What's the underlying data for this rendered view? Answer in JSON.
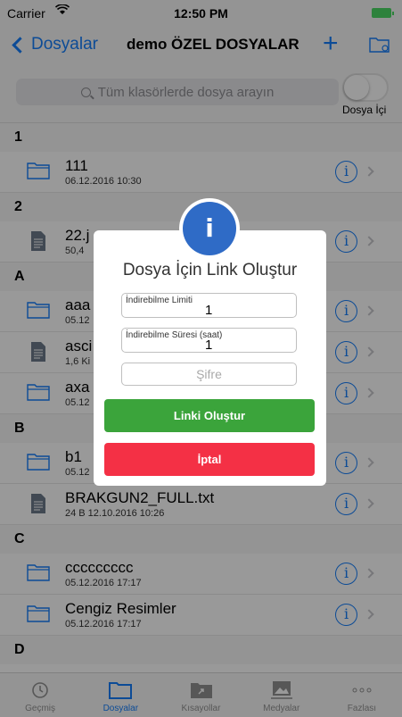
{
  "status_bar": {
    "carrier": "Carrier",
    "time": "12:50 PM"
  },
  "nav": {
    "back_label": "Dosyalar",
    "title": "demo ÖZEL DOSYALAR",
    "add": "+"
  },
  "search": {
    "placeholder": "Tüm klasörlerde dosya arayın",
    "toggle_label": "Dosya İçi"
  },
  "sections": [
    {
      "letter": "1",
      "rows": [
        {
          "name": "111",
          "meta": "06.12.2016 10:30",
          "icon": "folder-icon"
        }
      ]
    },
    {
      "letter": "2",
      "rows": [
        {
          "name": "22.j",
          "meta": "50,4",
          "icon": "file-icon"
        }
      ]
    },
    {
      "letter": "A",
      "rows": [
        {
          "name": "aaa",
          "meta": "05.12",
          "icon": "folder-icon"
        },
        {
          "name": "asci",
          "meta": "1,6 Ki",
          "icon": "file-icon"
        },
        {
          "name": "axa",
          "meta": "05.12",
          "icon": "folder-icon"
        }
      ]
    },
    {
      "letter": "B",
      "rows": [
        {
          "name": "b1",
          "meta": "05.12",
          "icon": "folder-icon"
        },
        {
          "name": "BRAKGUN2_FULL.txt",
          "meta": "24 B   12.10.2016 10:26",
          "icon": "file-icon"
        }
      ]
    },
    {
      "letter": "C",
      "rows": [
        {
          "name": "ccccccccc",
          "meta": "05.12.2016 17:17",
          "icon": "folder-icon"
        },
        {
          "name": "Cengiz Resimler",
          "meta": "05.12.2016 17:17",
          "icon": "folder-icon"
        }
      ]
    },
    {
      "letter": "D",
      "rows": []
    }
  ],
  "tabs": [
    {
      "label": "Geçmiş",
      "icon": "history-icon",
      "active": false
    },
    {
      "label": "Dosyalar",
      "icon": "folder-tab-icon",
      "active": true
    },
    {
      "label": "Kısayollar",
      "icon": "shortcut-folder-icon",
      "active": false
    },
    {
      "label": "Medyalar",
      "icon": "media-icon",
      "active": false
    },
    {
      "label": "Fazlası",
      "icon": "more-icon",
      "active": false
    }
  ],
  "dialog": {
    "badge": "i",
    "title": "Dosya İçin Link Oluştur",
    "limit_label": "İndirebilme Limiti",
    "limit_value": "1",
    "duration_label": "İndirebilme Süresi (saat)",
    "duration_value": "1",
    "password_placeholder": "Şifre",
    "create_button": "Linki Oluştur",
    "cancel_button": "İptal"
  },
  "colors": {
    "accent": "#157efb",
    "green": "#3ba43b",
    "red": "#f43045",
    "badge": "#2f6bc6"
  }
}
